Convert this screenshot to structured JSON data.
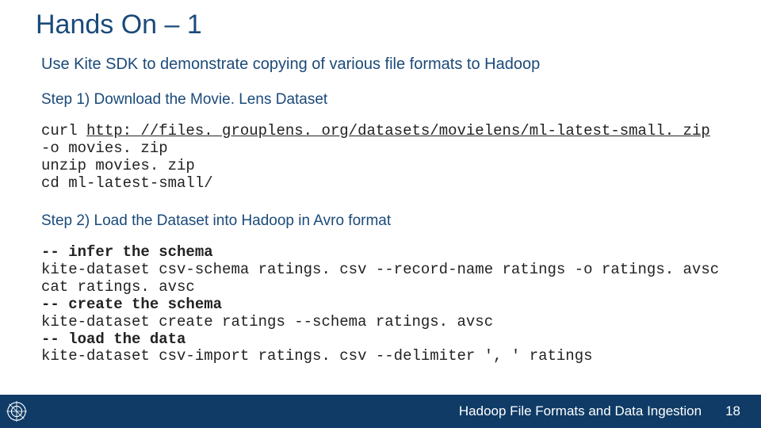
{
  "title": "Hands On – 1",
  "intro": "Use Kite SDK to demonstrate copying of various file formats to Hadoop",
  "step1_label": "Step 1) Download the Movie. Lens Dataset",
  "code1": {
    "prefix": "curl ",
    "url": "http: //files. grouplens. org/datasets/movielens/ml-latest-small. zip",
    "suffix": " -o movies. zip",
    "line2": "unzip movies. zip",
    "line3": "cd ml-latest-small/"
  },
  "step2_label": "Step 2) Load the Dataset into Hadoop in Avro format",
  "code2": {
    "c1": "-- infer the schema",
    "l1": "kite-dataset csv-schema ratings. csv --record-name ratings -o ratings. avsc",
    "l2": "cat ratings. avsc",
    "c2": "-- create the schema",
    "l3": "kite-dataset create ratings --schema ratings. avsc",
    "c3": "-- load the data",
    "l4": "kite-dataset csv-import ratings. csv --delimiter ', ' ratings"
  },
  "footer": {
    "text": "Hadoop File Formats and Data Ingestion",
    "page": "18"
  }
}
